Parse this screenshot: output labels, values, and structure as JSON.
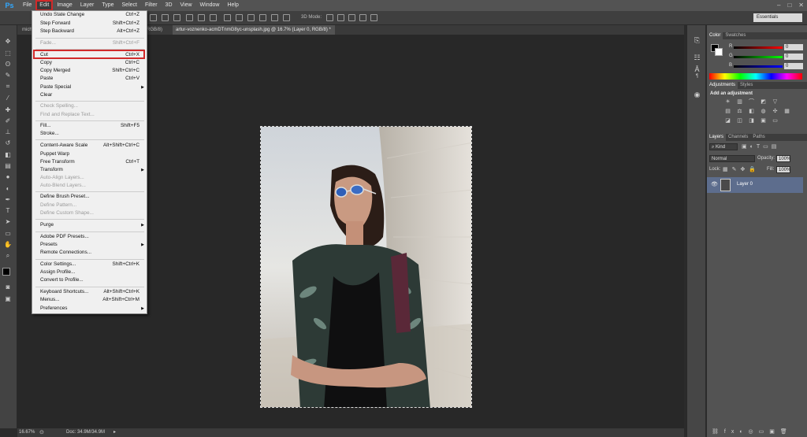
{
  "menubar": {
    "logo": "Ps",
    "items": [
      "File",
      "Edit",
      "Image",
      "Layer",
      "Type",
      "Select",
      "Filter",
      "3D",
      "View",
      "Window",
      "Help"
    ]
  },
  "options": {
    "three_d_mode": "3D Mode:",
    "workspace": "Essentials"
  },
  "tabs": [
    {
      "label": "mich"
    },
    {
      "label": "RGB/8)"
    },
    {
      "label": "artur-voznenko-acmDTnmG8yc-unsplash.jpg @ 16.7% (Layer 0, RGB/8) *"
    }
  ],
  "edit_menu": {
    "items": [
      {
        "label": "Undo State Change",
        "shortcut": "Ctrl+Z",
        "disabled": false
      },
      {
        "label": "Step Forward",
        "shortcut": "Shift+Ctrl+Z",
        "disabled": false
      },
      {
        "label": "Step Backward",
        "shortcut": "Alt+Ctrl+Z",
        "disabled": false
      },
      {
        "label": "Fade...",
        "shortcut": "Shift+Ctrl+F",
        "disabled": true
      },
      {
        "label": "Cut",
        "shortcut": "Ctrl+X",
        "disabled": false
      },
      {
        "label": "Copy",
        "shortcut": "Ctrl+C",
        "disabled": false
      },
      {
        "label": "Copy Merged",
        "shortcut": "Shift+Ctrl+C",
        "disabled": false
      },
      {
        "label": "Paste",
        "shortcut": "Ctrl+V",
        "disabled": false
      },
      {
        "label": "Paste Special",
        "shortcut": "",
        "disabled": false
      },
      {
        "label": "Clear",
        "shortcut": "",
        "disabled": false
      },
      {
        "label": "Check Spelling...",
        "shortcut": "",
        "disabled": true
      },
      {
        "label": "Find and Replace Text...",
        "shortcut": "",
        "disabled": true
      },
      {
        "label": "Fill...",
        "shortcut": "Shift+F5",
        "disabled": false
      },
      {
        "label": "Stroke...",
        "shortcut": "",
        "disabled": false
      },
      {
        "label": "Content-Aware Scale",
        "shortcut": "Alt+Shift+Ctrl+C",
        "disabled": false
      },
      {
        "label": "Puppet Warp",
        "shortcut": "",
        "disabled": false
      },
      {
        "label": "Free Transform",
        "shortcut": "Ctrl+T",
        "disabled": false
      },
      {
        "label": "Transform",
        "shortcut": "",
        "disabled": false
      },
      {
        "label": "Auto-Align Layers...",
        "shortcut": "",
        "disabled": true
      },
      {
        "label": "Auto-Blend Layers...",
        "shortcut": "",
        "disabled": true
      },
      {
        "label": "Define Brush Preset...",
        "shortcut": "",
        "disabled": false
      },
      {
        "label": "Define Pattern...",
        "shortcut": "",
        "disabled": true
      },
      {
        "label": "Define Custom Shape...",
        "shortcut": "",
        "disabled": true
      },
      {
        "label": "Purge",
        "shortcut": "",
        "disabled": false
      },
      {
        "label": "Adobe PDF Presets...",
        "shortcut": "",
        "disabled": false
      },
      {
        "label": "Presets",
        "shortcut": "",
        "disabled": false
      },
      {
        "label": "Remote Connections...",
        "shortcut": "",
        "disabled": false
      },
      {
        "label": "Color Settings...",
        "shortcut": "Shift+Ctrl+K",
        "disabled": false
      },
      {
        "label": "Assign Profile...",
        "shortcut": "",
        "disabled": false
      },
      {
        "label": "Convert to Profile...",
        "shortcut": "",
        "disabled": false
      },
      {
        "label": "Keyboard Shortcuts...",
        "shortcut": "Alt+Shift+Ctrl+K",
        "disabled": false
      },
      {
        "label": "Menus...",
        "shortcut": "Alt+Shift+Ctrl+M",
        "disabled": false
      },
      {
        "label": "Preferences",
        "shortcut": "",
        "disabled": false
      }
    ]
  },
  "color_panel": {
    "tabs": [
      "Color",
      "Swatches"
    ],
    "channels": [
      {
        "label": "R",
        "value": "0"
      },
      {
        "label": "G",
        "value": "0"
      },
      {
        "label": "B",
        "value": "0"
      }
    ]
  },
  "adjustments_panel": {
    "tabs": [
      "Adjustments",
      "Styles"
    ],
    "title": "Add an adjustment"
  },
  "layers_panel": {
    "tabs": [
      "Layers",
      "Channels",
      "Paths"
    ],
    "kind": "Kind",
    "blend_mode": "Normal",
    "opacity_label": "Opacity:",
    "opacity": "100%",
    "lock_label": "Lock:",
    "fill_label": "Fill:",
    "fill": "100%",
    "layer_name": "Layer 0"
  },
  "status": {
    "zoom": "16.67%",
    "doc": "Doc: 34.9M/34.9M"
  },
  "colors": {
    "accent_highlight": "#d12a2a",
    "selected_layer": "#5d6d8d"
  }
}
